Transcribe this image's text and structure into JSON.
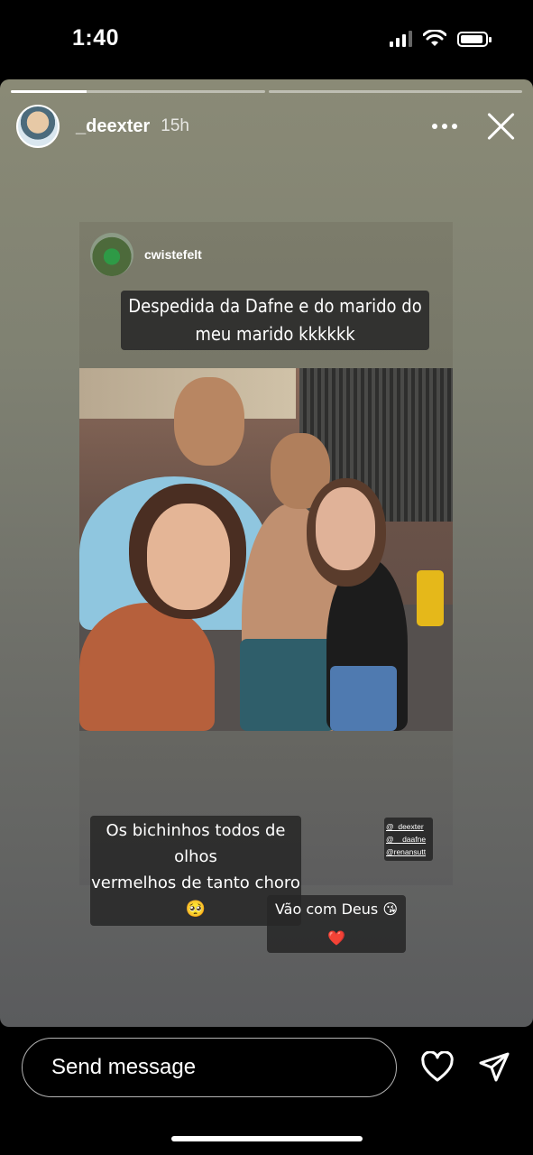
{
  "status_bar": {
    "time": "1:40"
  },
  "story": {
    "progress": [
      1,
      0
    ],
    "header": {
      "username": "_deexter",
      "time": "15h"
    },
    "post": {
      "username": "cwistefelt",
      "caption_top": [
        "Despedida da Dafne e do marido do",
        "meu marido kkkkkk"
      ],
      "caption_middle": [
        "Os bichinhos todos de olhos",
        "vermelhos de tanto choro 🥺"
      ],
      "tags": [
        "@_deexter",
        "@__daafne",
        "@renansutt"
      ],
      "caption_bottom": "Vão com Deus 😘❤️"
    }
  },
  "reply": {
    "placeholder": "Send message"
  }
}
